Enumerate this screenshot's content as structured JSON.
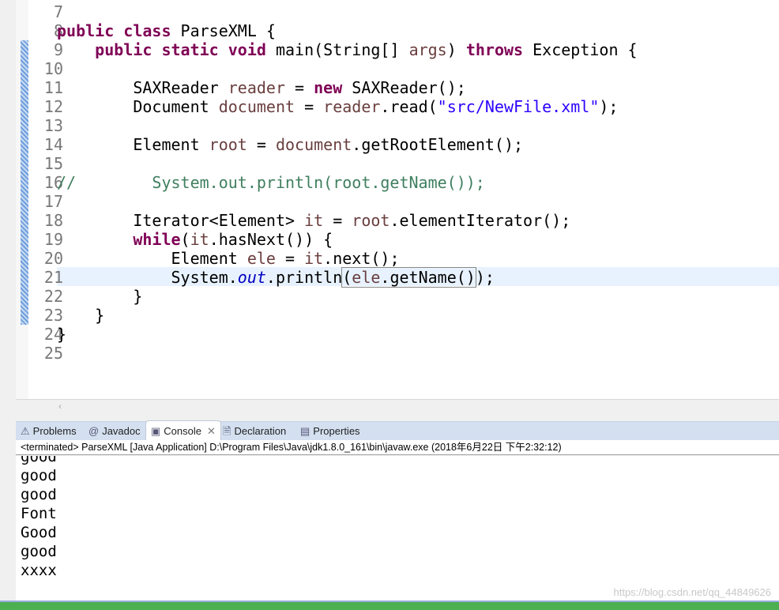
{
  "editor": {
    "lines": [
      {
        "n": "7",
        "html": ""
      },
      {
        "n": "8",
        "html": "<span class='kw'>public</span> <span class='kw'>class</span> ParseXML {"
      },
      {
        "n": "9",
        "html": "    <span class='kw'>public</span> <span class='kw'>static</span> <span class='kw'>void</span> main(String[] <span class='lv'>args</span>) <span class='kw'>throws</span> Exception {"
      },
      {
        "n": "10",
        "html": ""
      },
      {
        "n": "11",
        "html": "        SAXReader <span class='lv'>reader</span> = <span class='kw'>new</span> SAXReader();"
      },
      {
        "n": "12",
        "html": "        Document <span class='lv'>document</span> = <span class='lv'>reader</span>.read(<span class='st'>\"src/NewFile.xml\"</span>);"
      },
      {
        "n": "13",
        "html": ""
      },
      {
        "n": "14",
        "html": "        Element <span class='lv'>root</span> = <span class='lv'>document</span>.getRootElement();"
      },
      {
        "n": "15",
        "html": ""
      },
      {
        "n": "16",
        "html": "<span class='cm'>//        System.out.println(root.getName());</span>"
      },
      {
        "n": "17",
        "html": ""
      },
      {
        "n": "18",
        "html": "        Iterator&lt;Element&gt; <span class='lv'>it</span> = <span class='lv'>root</span>.elementIterator();"
      },
      {
        "n": "19",
        "html": "        <span class='kw'>while</span>(<span class='lv'>it</span>.hasNext()) {"
      },
      {
        "n": "20",
        "html": "            Element <span class='lv'>ele</span> = <span class='lv'>it</span>.next();"
      },
      {
        "n": "21",
        "html": "            System.<span class='sf'>out</span>.println<span style='outline:1px solid #888'>(<span class='lv'>ele</span>.getName()</span>);"
      },
      {
        "n": "22",
        "html": "        }"
      },
      {
        "n": "23",
        "html": "    }"
      },
      {
        "n": "24",
        "html": "}"
      },
      {
        "n": "25",
        "html": ""
      }
    ]
  },
  "tabs": [
    {
      "label": "Problems",
      "icon": "problems-icon"
    },
    {
      "label": "Javadoc",
      "icon": "at-icon"
    },
    {
      "label": "Console",
      "icon": "console-icon",
      "active": true
    },
    {
      "label": "Declaration",
      "icon": "declaration-icon"
    },
    {
      "label": "Properties",
      "icon": "properties-icon"
    }
  ],
  "console": {
    "status": "<terminated> ParseXML [Java Application] D:\\Program Files\\Java\\jdk1.8.0_161\\bin\\javaw.exe (2018年6月22日 下午2:32:12)",
    "output": [
      "good",
      "good",
      "good",
      "Font",
      "Good",
      "good",
      "xxxx"
    ]
  },
  "watermark": "https://blog.csdn.net/qq_44849626"
}
